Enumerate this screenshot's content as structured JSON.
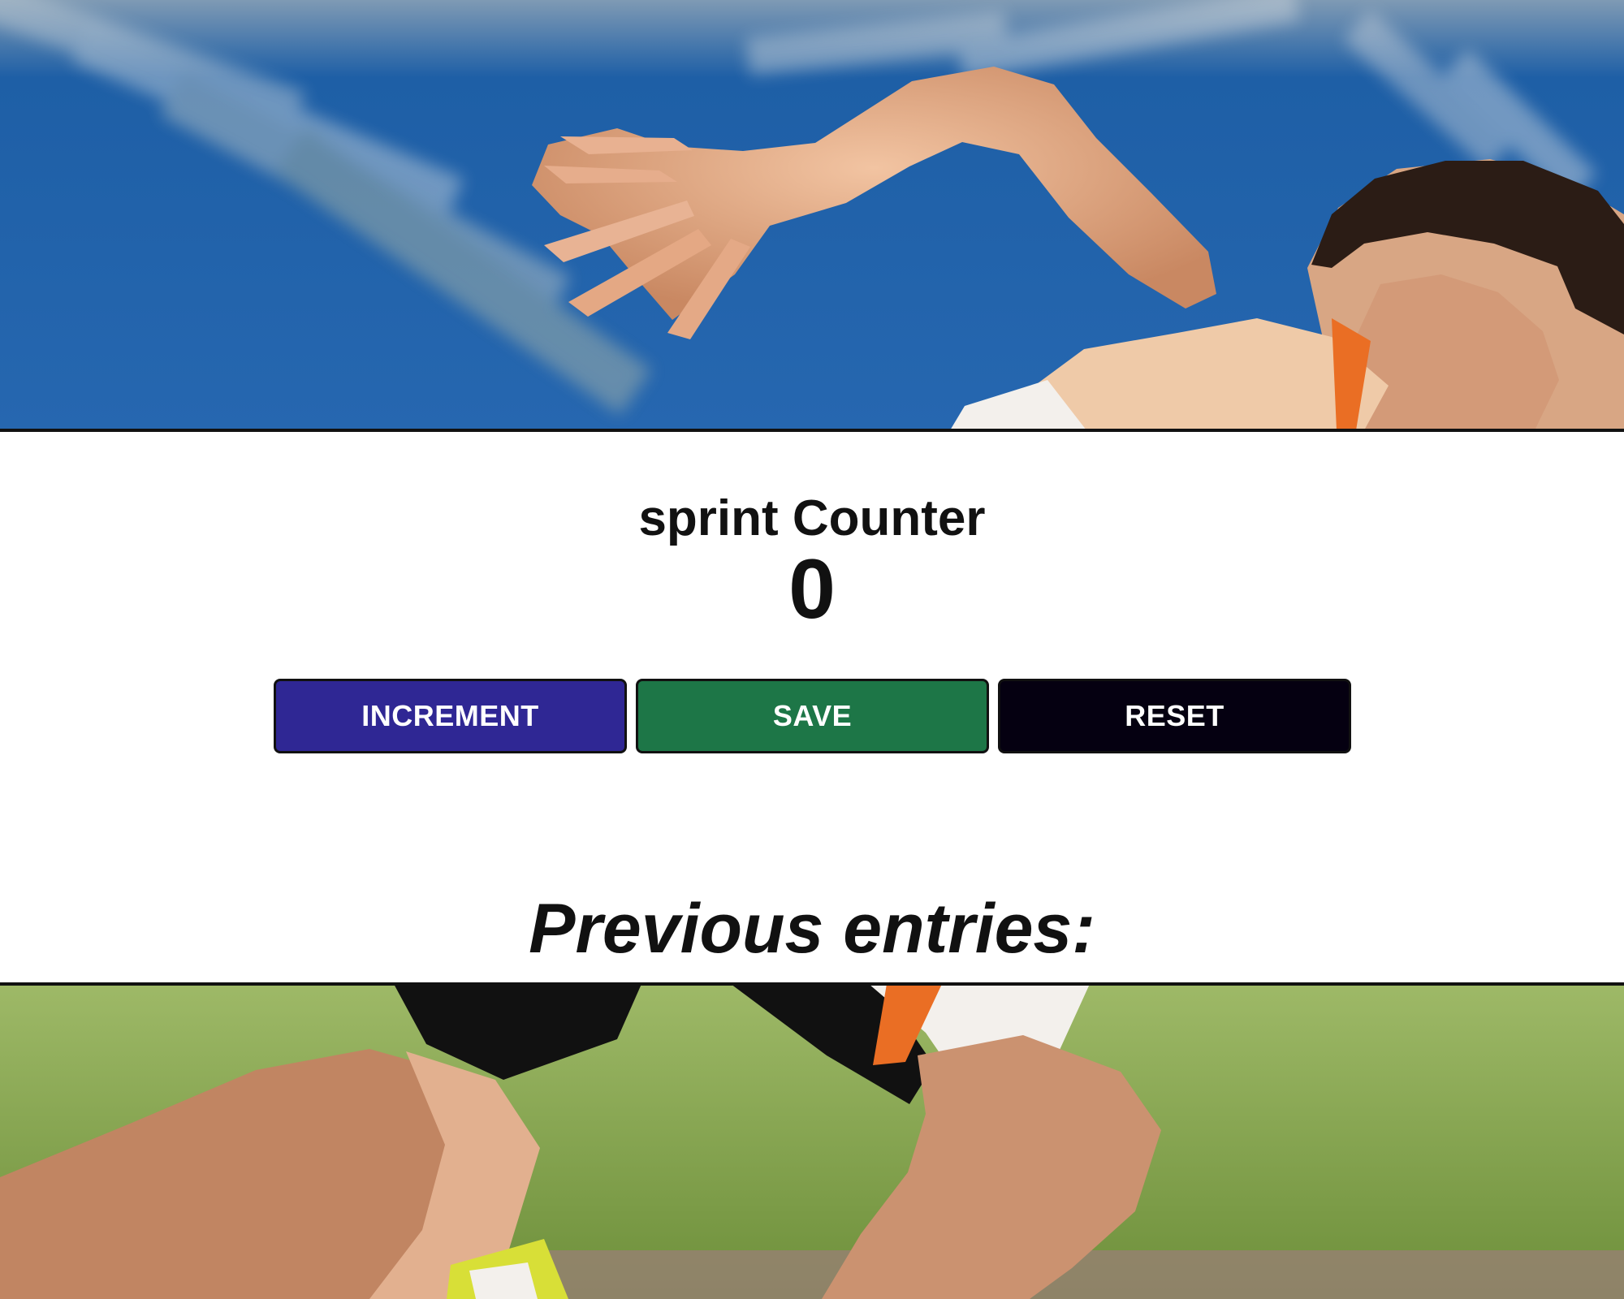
{
  "app": {
    "title": "sprint Counter",
    "count": "0",
    "entries_heading": "Previous entries:"
  },
  "buttons": {
    "increment": {
      "label": "INCREMENT",
      "color": "#2f2794"
    },
    "save": {
      "label": "SAVE",
      "color": "#1d7647"
    },
    "reset": {
      "label": "RESET",
      "color": "#050011"
    }
  },
  "background": {
    "image": "sprinter photo",
    "colors": {
      "stadium_blue": "#1e5fa6",
      "grass_green": "#8aaa54",
      "skin": "#d9a07c",
      "hair": "#2b1c15",
      "shorts": "#111111",
      "uniform_white": "#f3f0ec",
      "accent_orange": "#ea6e24"
    }
  }
}
